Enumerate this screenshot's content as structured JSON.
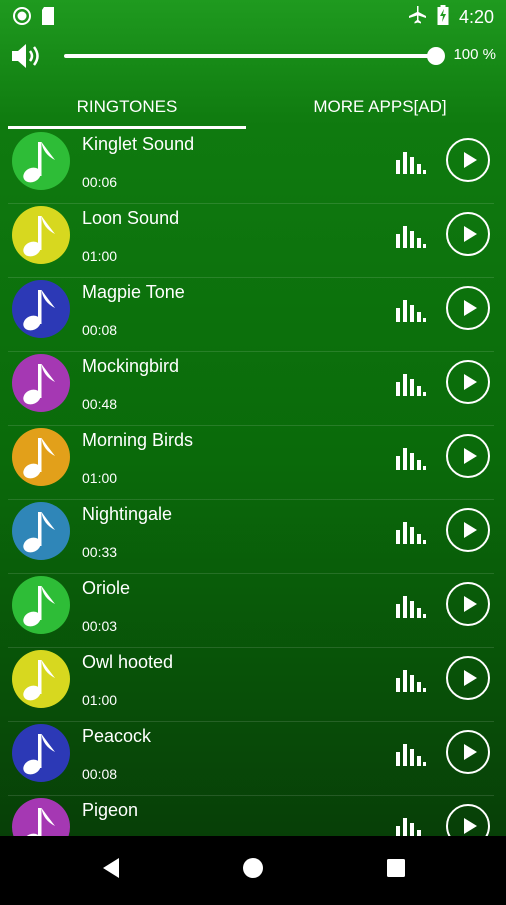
{
  "status_bar": {
    "time": "4:20"
  },
  "volume": {
    "percent_label": "100 %",
    "level": 1.0
  },
  "tabs": [
    {
      "label": "RINGTONES",
      "selected": true
    },
    {
      "label": "MORE APPS[AD]",
      "selected": false
    }
  ],
  "ringtones": [
    {
      "title": "Kinglet Sound",
      "duration": "00:06",
      "color": "#2ebd37"
    },
    {
      "title": "Loon Sound",
      "duration": "01:00",
      "color": "#d7d81f"
    },
    {
      "title": "Magpie Tone",
      "duration": "00:08",
      "color": "#2c39b6"
    },
    {
      "title": "Mockingbird",
      "duration": "00:48",
      "color": "#a538b3"
    },
    {
      "title": "Morning Birds",
      "duration": "01:00",
      "color": "#e2a01a"
    },
    {
      "title": "Nightingale",
      "duration": "00:33",
      "color": "#2f86b8"
    },
    {
      "title": "Oriole",
      "duration": "00:03",
      "color": "#2ebd37"
    },
    {
      "title": "Owl hooted",
      "duration": "01:00",
      "color": "#d7d81f"
    },
    {
      "title": "Peacock",
      "duration": "00:08",
      "color": "#2c39b6"
    },
    {
      "title": "Pigeon",
      "duration": "",
      "color": "#a538b3"
    }
  ],
  "icons": {
    "status_left": [
      "record-circle-icon",
      "sd-card-icon"
    ],
    "status_right": [
      "airplane-mode-icon",
      "battery-charging-icon"
    ],
    "volume": "speaker-icon",
    "row_note": "music-note-icon",
    "row_bars": "equalizer-icon",
    "row_play": "play-icon",
    "nav": [
      "back-icon",
      "home-icon",
      "recents-icon"
    ]
  }
}
